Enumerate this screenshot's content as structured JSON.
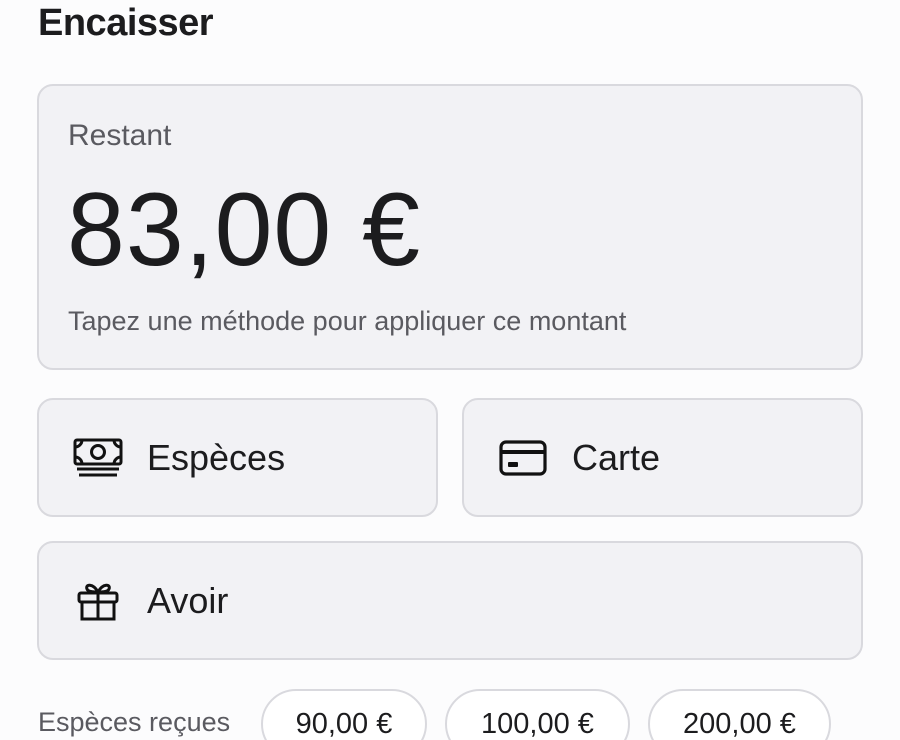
{
  "header": {
    "title": "Encaisser"
  },
  "remaining": {
    "label": "Restant",
    "amount": "83,00 €",
    "hint": "Tapez une méthode pour appliquer ce montant"
  },
  "methods": [
    {
      "label": "Espèces",
      "icon": "banknote-icon"
    },
    {
      "label": "Carte",
      "icon": "credit-card-icon"
    },
    {
      "label": "Avoir",
      "icon": "gift-icon"
    }
  ],
  "cash_received": {
    "label": "Espèces reçues",
    "quick_amounts": [
      "90,00 €",
      "100,00 €",
      "200,00 €"
    ]
  },
  "colors": {
    "background": "#fcfcfd",
    "card_background": "#f2f2f5",
    "border": "#d9d9de",
    "text_primary": "#1c1c1e",
    "text_secondary": "#5a5a60"
  }
}
